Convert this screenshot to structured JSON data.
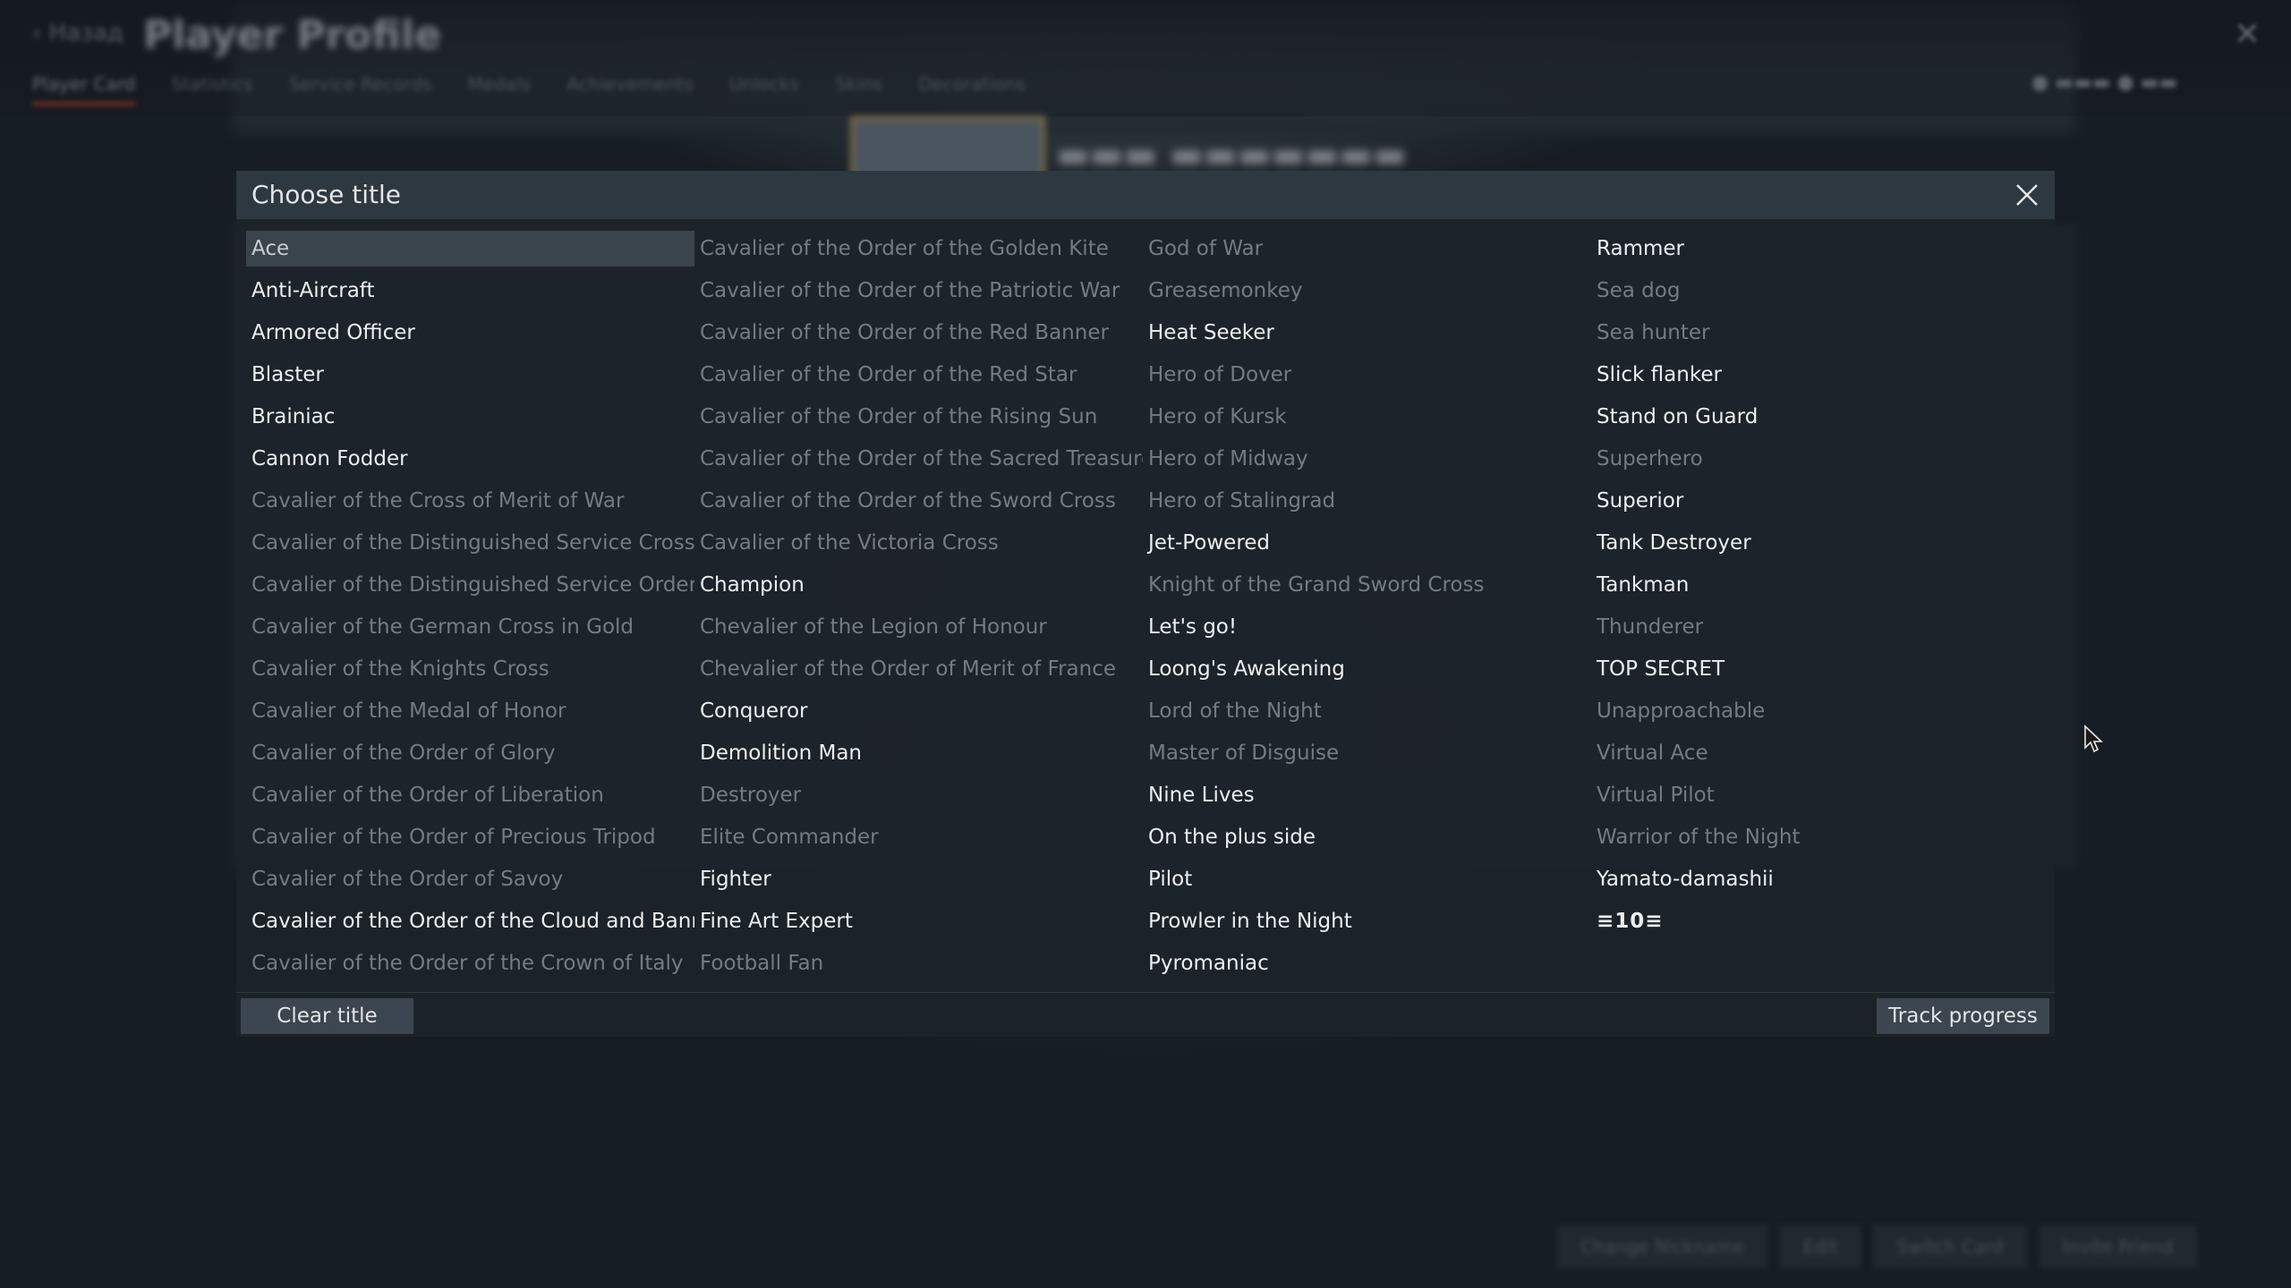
{
  "background": {
    "back_label": "Назад",
    "page_title": "Player Profile",
    "tabs": [
      "Player Card",
      "Statistics",
      "Service Records",
      "Medals",
      "Achievements",
      "Unlocks",
      "Skins",
      "Decorations"
    ],
    "bottom_buttons": [
      "Change Nickname",
      "Edit",
      "Switch Card",
      "Invite Friend"
    ]
  },
  "dialog": {
    "title": "Choose title",
    "close_icon": "close-icon",
    "titles": [
      {
        "label": "Ace",
        "state": "selected"
      },
      {
        "label": "Anti-Aircraft",
        "state": "unlocked"
      },
      {
        "label": "Armored Officer",
        "state": "unlocked"
      },
      {
        "label": "Blaster",
        "state": "unlocked"
      },
      {
        "label": "Brainiac",
        "state": "unlocked"
      },
      {
        "label": "Cannon Fodder",
        "state": "unlocked"
      },
      {
        "label": "Cavalier of the Cross of Merit of War",
        "state": "locked"
      },
      {
        "label": "Cavalier of the Distinguished Service Cross",
        "state": "locked"
      },
      {
        "label": "Cavalier of the Distinguished Service Order",
        "state": "locked"
      },
      {
        "label": "Cavalier of the German Cross in Gold",
        "state": "locked"
      },
      {
        "label": "Cavalier of the Knights Cross",
        "state": "locked"
      },
      {
        "label": "Cavalier of the Medal of Honor",
        "state": "locked"
      },
      {
        "label": "Cavalier of the Order of Glory",
        "state": "locked"
      },
      {
        "label": "Cavalier of the Order of Liberation",
        "state": "locked"
      },
      {
        "label": "Cavalier of the Order of Precious Tripod",
        "state": "locked"
      },
      {
        "label": "Cavalier of the Order of Savoy",
        "state": "locked"
      },
      {
        "label": "Cavalier of the Order of the Cloud and Banner",
        "state": "unlocked"
      },
      {
        "label": "Cavalier of the Order of the Crown of Italy",
        "state": "locked"
      },
      {
        "label": "Cavalier of the Order of the Golden Kite",
        "state": "locked"
      },
      {
        "label": "Cavalier of the Order of the Patriotic War",
        "state": "locked"
      },
      {
        "label": "Cavalier of the Order of the Red Banner",
        "state": "locked"
      },
      {
        "label": "Cavalier of the Order of the Red Star",
        "state": "locked"
      },
      {
        "label": "Cavalier of the Order of the Rising Sun",
        "state": "locked"
      },
      {
        "label": "Cavalier of the Order of the Sacred Treasure",
        "state": "locked"
      },
      {
        "label": "Cavalier of the Order of the Sword Cross",
        "state": "locked"
      },
      {
        "label": "Cavalier of the Victoria Cross",
        "state": "locked"
      },
      {
        "label": "Champion",
        "state": "unlocked"
      },
      {
        "label": "Chevalier of the Legion of Honour",
        "state": "locked"
      },
      {
        "label": "Chevalier of the Order of Merit of France",
        "state": "locked"
      },
      {
        "label": "Conqueror",
        "state": "unlocked"
      },
      {
        "label": "Demolition Man",
        "state": "unlocked"
      },
      {
        "label": "Destroyer",
        "state": "locked"
      },
      {
        "label": "Elite Commander",
        "state": "locked"
      },
      {
        "label": "Fighter",
        "state": "unlocked"
      },
      {
        "label": "Fine Art Expert",
        "state": "unlocked"
      },
      {
        "label": "Football Fan",
        "state": "locked"
      },
      {
        "label": "God of War",
        "state": "locked"
      },
      {
        "label": "Greasemonkey",
        "state": "locked"
      },
      {
        "label": "Heat Seeker",
        "state": "unlocked"
      },
      {
        "label": "Hero of Dover",
        "state": "locked"
      },
      {
        "label": "Hero of Kursk",
        "state": "locked"
      },
      {
        "label": "Hero of Midway",
        "state": "locked"
      },
      {
        "label": "Hero of Stalingrad",
        "state": "locked"
      },
      {
        "label": "Jet-Powered",
        "state": "unlocked"
      },
      {
        "label": "Knight of the Grand Sword Cross",
        "state": "locked"
      },
      {
        "label": "Let's go!",
        "state": "unlocked"
      },
      {
        "label": "Loong's Awakening",
        "state": "unlocked"
      },
      {
        "label": "Lord of the Night",
        "state": "locked"
      },
      {
        "label": "Master of Disguise",
        "state": "locked"
      },
      {
        "label": "Nine Lives",
        "state": "unlocked"
      },
      {
        "label": "On the plus side",
        "state": "unlocked"
      },
      {
        "label": "Pilot",
        "state": "unlocked"
      },
      {
        "label": "Prowler in the Night",
        "state": "unlocked"
      },
      {
        "label": "Pyromaniac",
        "state": "unlocked"
      },
      {
        "label": "Rammer",
        "state": "unlocked"
      },
      {
        "label": "Sea dog",
        "state": "locked"
      },
      {
        "label": "Sea hunter",
        "state": "locked"
      },
      {
        "label": "Slick flanker",
        "state": "unlocked"
      },
      {
        "label": "Stand on Guard",
        "state": "unlocked"
      },
      {
        "label": "Superhero",
        "state": "locked"
      },
      {
        "label": "Superior",
        "state": "unlocked"
      },
      {
        "label": "Tank Destroyer",
        "state": "unlocked"
      },
      {
        "label": "Tankman",
        "state": "unlocked"
      },
      {
        "label": "Thunderer",
        "state": "locked"
      },
      {
        "label": "TOP SECRET",
        "state": "unlocked"
      },
      {
        "label": "Unapproachable",
        "state": "locked"
      },
      {
        "label": "Virtual Ace",
        "state": "locked"
      },
      {
        "label": "Virtual Pilot",
        "state": "locked"
      },
      {
        "label": "Warrior of the Night",
        "state": "locked"
      },
      {
        "label": "Yamato-damashii",
        "state": "unlocked"
      },
      {
        "label": "≡10≡",
        "state": "unlocked",
        "badge": true
      }
    ],
    "clear_label": "Clear title",
    "track_label": "Track progress"
  },
  "colors": {
    "dialog_bg": "#1c232a",
    "header_bg": "#2e3841",
    "unlocked_text": "#edeff1",
    "locked_text": "#737c84",
    "selected_bg": "#3a444d",
    "button_bg": "#3c4650"
  }
}
